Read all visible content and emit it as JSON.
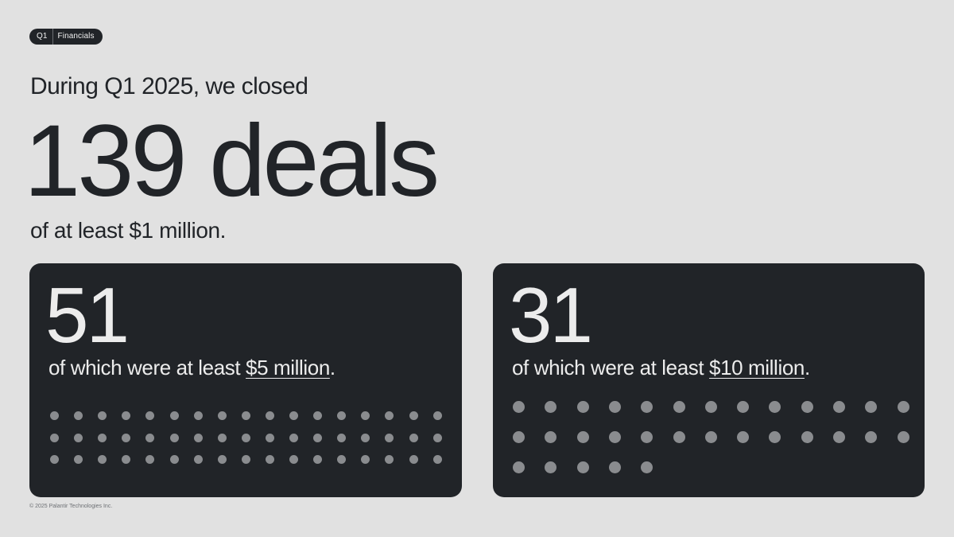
{
  "tag": {
    "quarter": "Q1",
    "section": "Financials"
  },
  "headline": {
    "intro": "During Q1 2025, we closed",
    "hero": "139 deals",
    "outro": "of at least $1 million."
  },
  "cards": [
    {
      "number": "51",
      "prefix": "of which were at least ",
      "amount": "$5 million",
      "suffix": ".",
      "dot_count": 51
    },
    {
      "number": "31",
      "prefix": "of which were at least ",
      "amount": "$10 million",
      "suffix": ".",
      "dot_count": 31
    }
  ],
  "footer": "© 2025 Palantir Technologies Inc.",
  "colors": {
    "background": "#e1e1e1",
    "card": "#212428",
    "dot": "#8a8c8f",
    "text_dark": "#212428",
    "text_light": "#ececec"
  }
}
